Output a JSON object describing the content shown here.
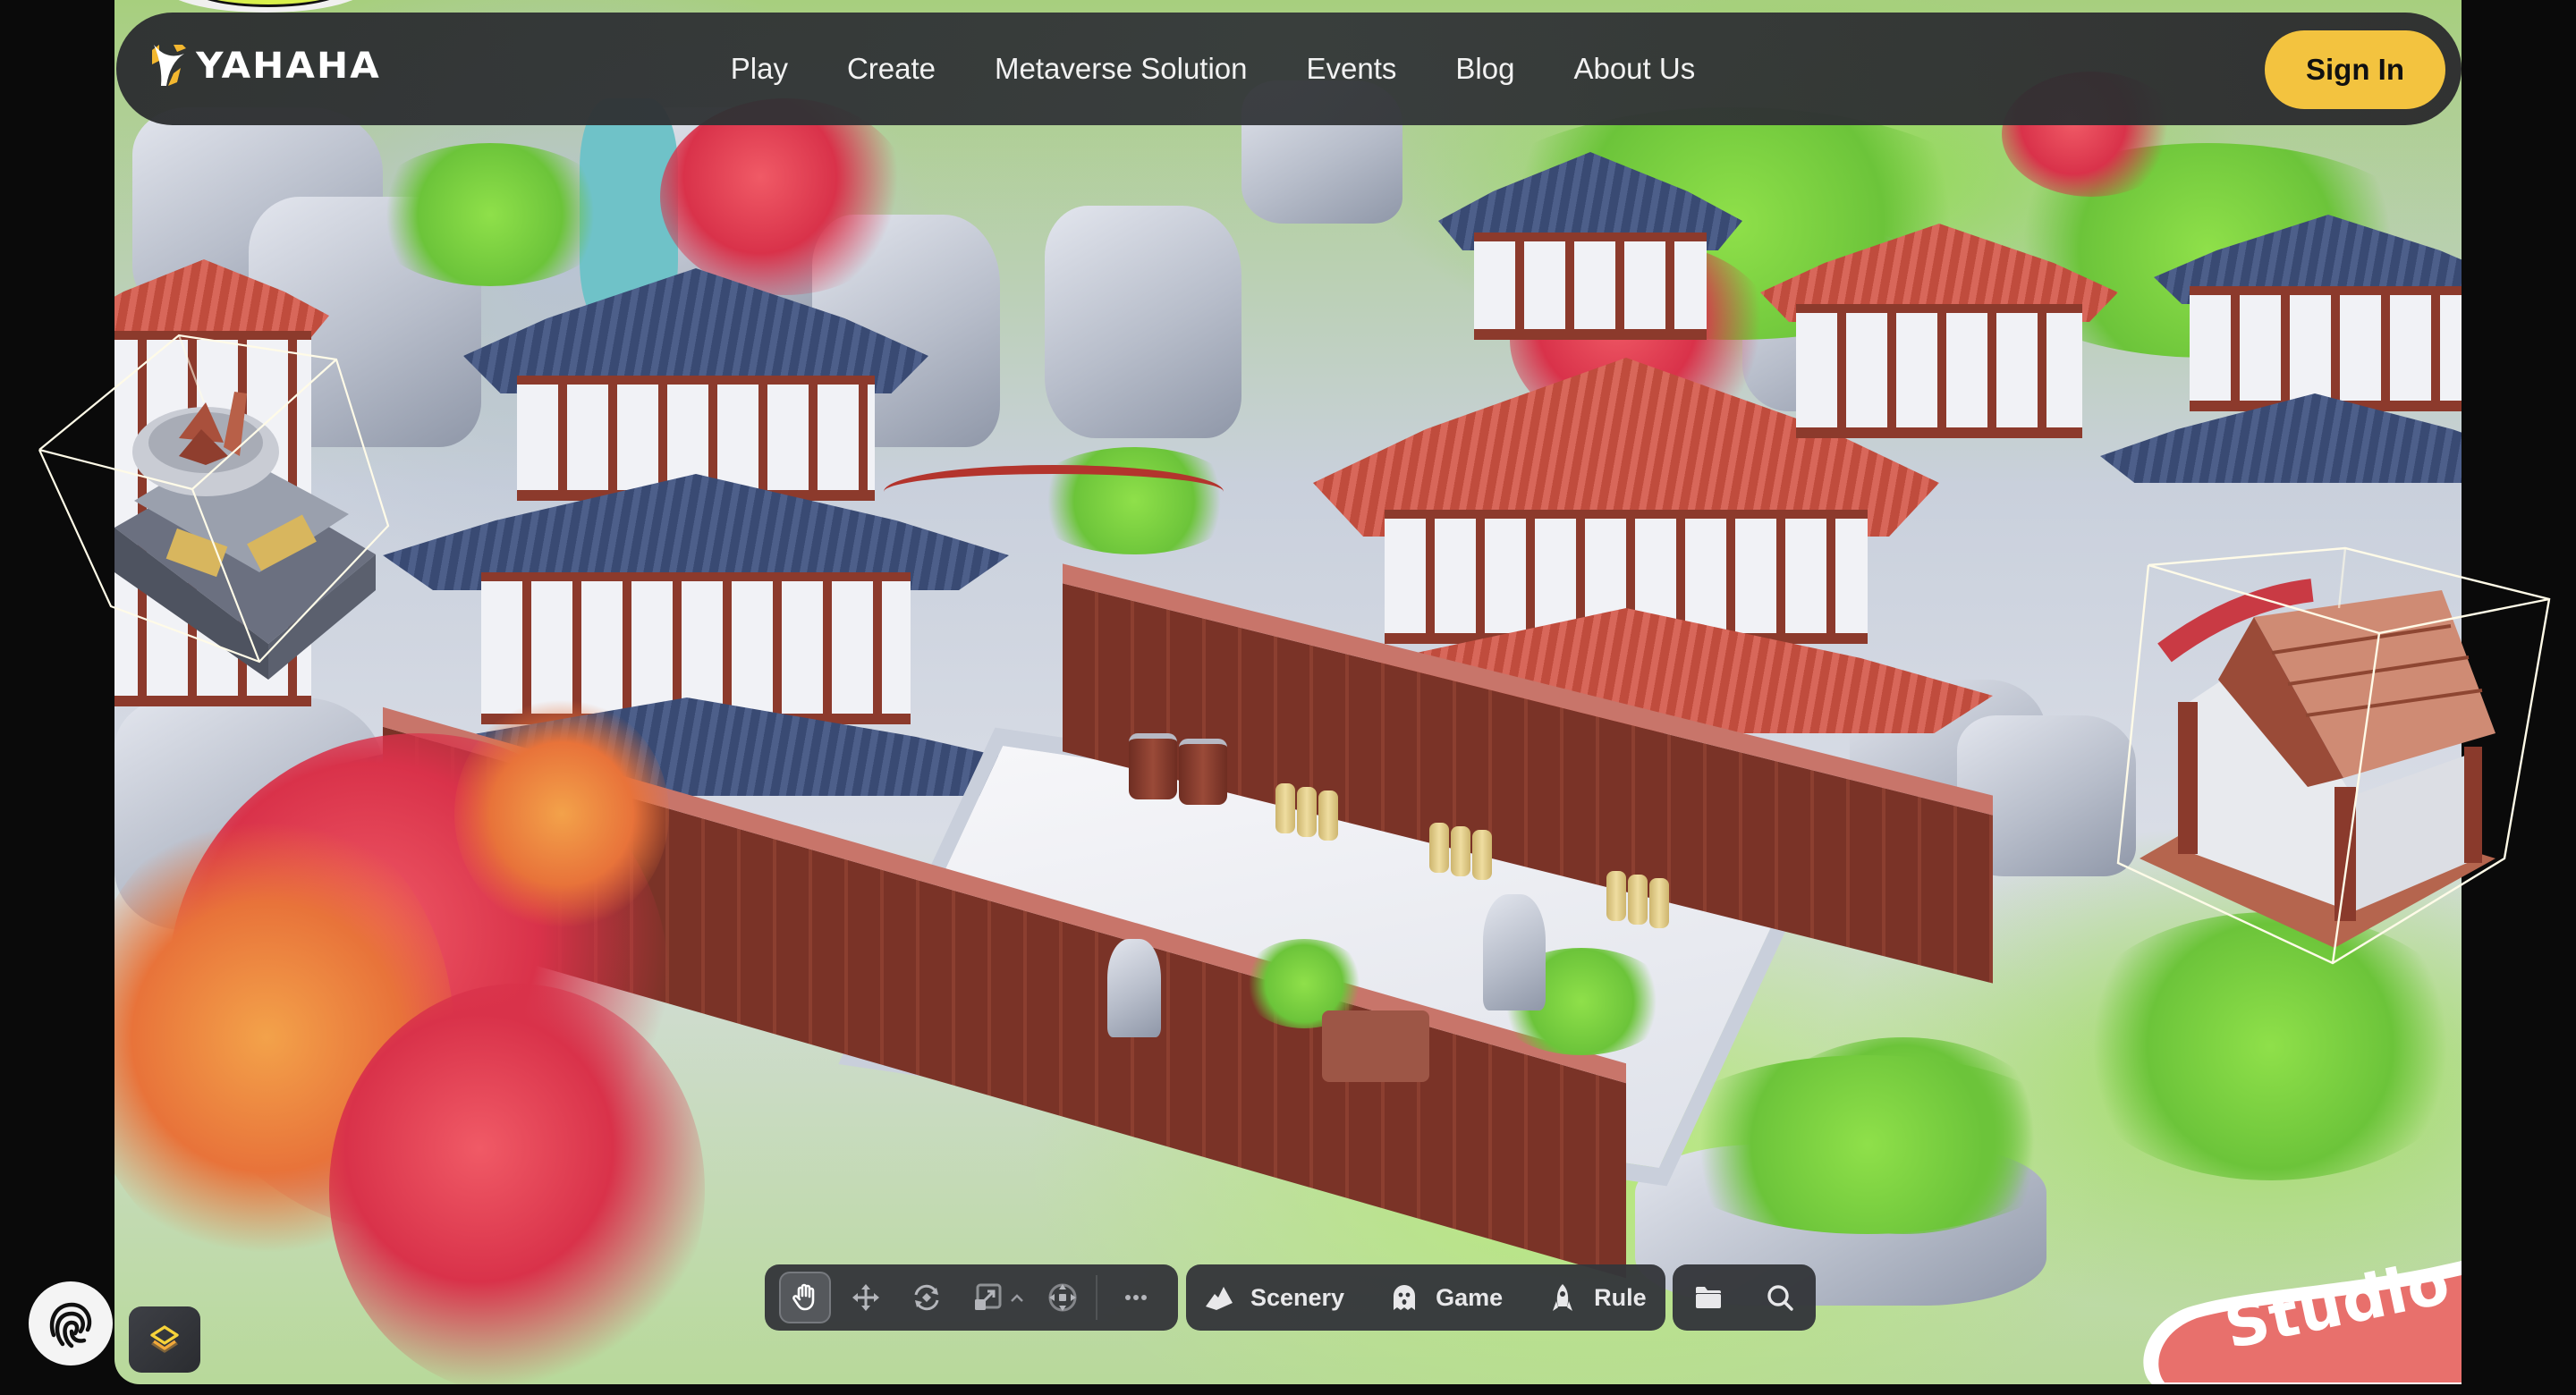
{
  "header": {
    "brand": "YAHAHA",
    "nav": [
      {
        "label": "Play"
      },
      {
        "label": "Create"
      },
      {
        "label": "Metaverse Solution"
      },
      {
        "label": "Events"
      },
      {
        "label": "Blog"
      },
      {
        "label": "About Us"
      }
    ],
    "signin_label": "Sign In"
  },
  "toolbar": {
    "tools": [
      {
        "name": "hand-tool",
        "icon": "hand-icon",
        "active": true
      },
      {
        "name": "move-tool",
        "icon": "move-arrows-icon",
        "active": false
      },
      {
        "name": "rotate-tool",
        "icon": "rotate-icon",
        "active": false
      },
      {
        "name": "scale-tool",
        "icon": "scale-icon",
        "active": false
      },
      {
        "name": "pivot-tool",
        "icon": "pivot-icon",
        "active": false
      }
    ],
    "more_icon": "more-horizontal-icon",
    "modes": [
      {
        "label": "Scenery",
        "icon": "mountain-icon"
      },
      {
        "label": "Game",
        "icon": "ghost-icon"
      },
      {
        "label": "Rule",
        "icon": "rocket-icon"
      }
    ],
    "misc": [
      {
        "icon": "folder-icon"
      },
      {
        "icon": "search-icon"
      }
    ]
  },
  "badge": {
    "label": "Studio"
  },
  "colors": {
    "accent": "#f3c33f",
    "header_bg": "#2f3133",
    "studio_badge": "#e8706c",
    "page_bg": "#0a0a0a",
    "layers_icon": "#f3c33f"
  }
}
